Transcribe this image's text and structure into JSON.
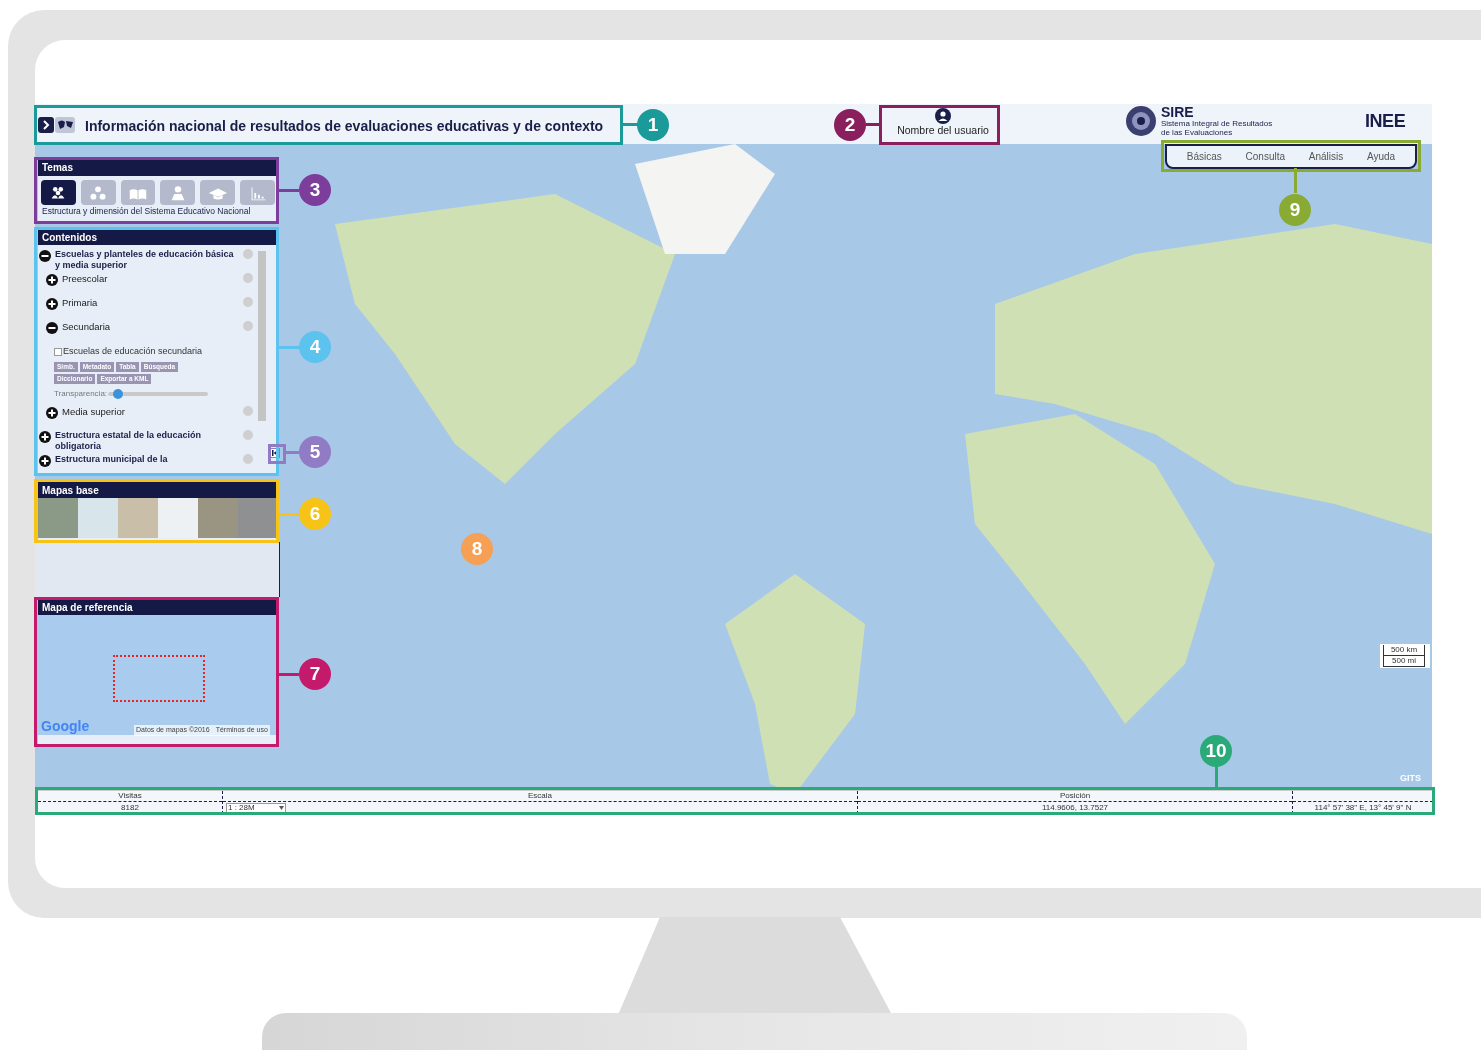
{
  "header": {
    "title": "Información nacional de resultados de evaluaciones educativas y de contexto",
    "user": "Nombre del usuario",
    "sire": {
      "name": "SIRE",
      "subtitle": "Sistema Integral de Resultados de las Evaluaciones"
    },
    "inee": "INEE",
    "nav": [
      {
        "label": "Básicas",
        "selected": false
      },
      {
        "label": "Consulta",
        "selected": false
      },
      {
        "label": "Análisis",
        "selected": false
      },
      {
        "label": "Ayuda",
        "selected": false
      }
    ]
  },
  "temas": {
    "title": "Temas",
    "caption": "Estructura y dimensión del Sistema Educativo Nacional",
    "icons": [
      {
        "kind": "people",
        "selected": true
      },
      {
        "kind": "group",
        "selected": false
      },
      {
        "kind": "book",
        "selected": false
      },
      {
        "kind": "person",
        "selected": false
      },
      {
        "kind": "graduation",
        "selected": false
      },
      {
        "kind": "chart",
        "selected": false
      }
    ]
  },
  "contenidos": {
    "title": "Contenidos",
    "items": [
      {
        "kind": "group",
        "label": "Escuelas y planteles de educación básica y media superior",
        "expanded": true,
        "children": [
          {
            "kind": "group",
            "label": "Preescolar",
            "expanded": false
          },
          {
            "kind": "group",
            "label": "Primaria",
            "expanded": false
          },
          {
            "kind": "group",
            "label": "Secundaria",
            "expanded": true,
            "children": [
              {
                "kind": "layer",
                "label": "Escuelas de educación secundaria",
                "checked": false,
                "tools": [
                  "Simb.",
                  "Metadato",
                  "Tabla",
                  "Búsqueda",
                  "Diccionario",
                  "Exportar a KML"
                ],
                "transparency_label": "Transparencia:",
                "level": 0.05
              }
            ]
          },
          {
            "kind": "group",
            "label": "Media superior",
            "expanded": false
          }
        ]
      },
      {
        "kind": "group",
        "label": "Estructura estatal de la educación obligatoria",
        "expanded": false
      },
      {
        "kind": "group",
        "label": "Estructura municipal de la",
        "expanded": false
      }
    ]
  },
  "mapas_base": {
    "title": "Mapas base",
    "thumbnails": [
      {
        "kind": "terrain"
      },
      {
        "kind": "light"
      },
      {
        "kind": "satellite"
      },
      {
        "kind": "street"
      },
      {
        "kind": "hybrid"
      },
      {
        "kind": "dark"
      }
    ]
  },
  "mapa_referencia": {
    "title": "Mapa de referencia",
    "google": "Google",
    "attribution": "Datos de mapas ©2016",
    "terms": "Términos de uso"
  },
  "map": {
    "scale": [
      "500 km",
      "500 mi"
    ],
    "credit": "GITS"
  },
  "status_bar": {
    "visits_label": "Visitas",
    "visits": "8182",
    "scale_label": "Escala",
    "scale": "1 : 28M",
    "position_label": "Posición",
    "position": "114.9606, 13.7527",
    "position_dms": "114° 57' 38\" E, 13° 45' 9\" N"
  },
  "callouts": [
    {
      "number": "1",
      "color": "#1b9a9a"
    },
    {
      "number": "2",
      "color": "#8a1f5e"
    },
    {
      "number": "3",
      "color": "#7c3d9b"
    },
    {
      "number": "4",
      "color": "#5cc2ee"
    },
    {
      "number": "5",
      "color": "#917bc4"
    },
    {
      "number": "6",
      "color": "#f6c316"
    },
    {
      "number": "7",
      "color": "#c41a6c"
    },
    {
      "number": "8",
      "color": "#f5a055"
    },
    {
      "number": "9",
      "color": "#89ab34"
    },
    {
      "number": "10",
      "color": "#2aaa78"
    }
  ]
}
